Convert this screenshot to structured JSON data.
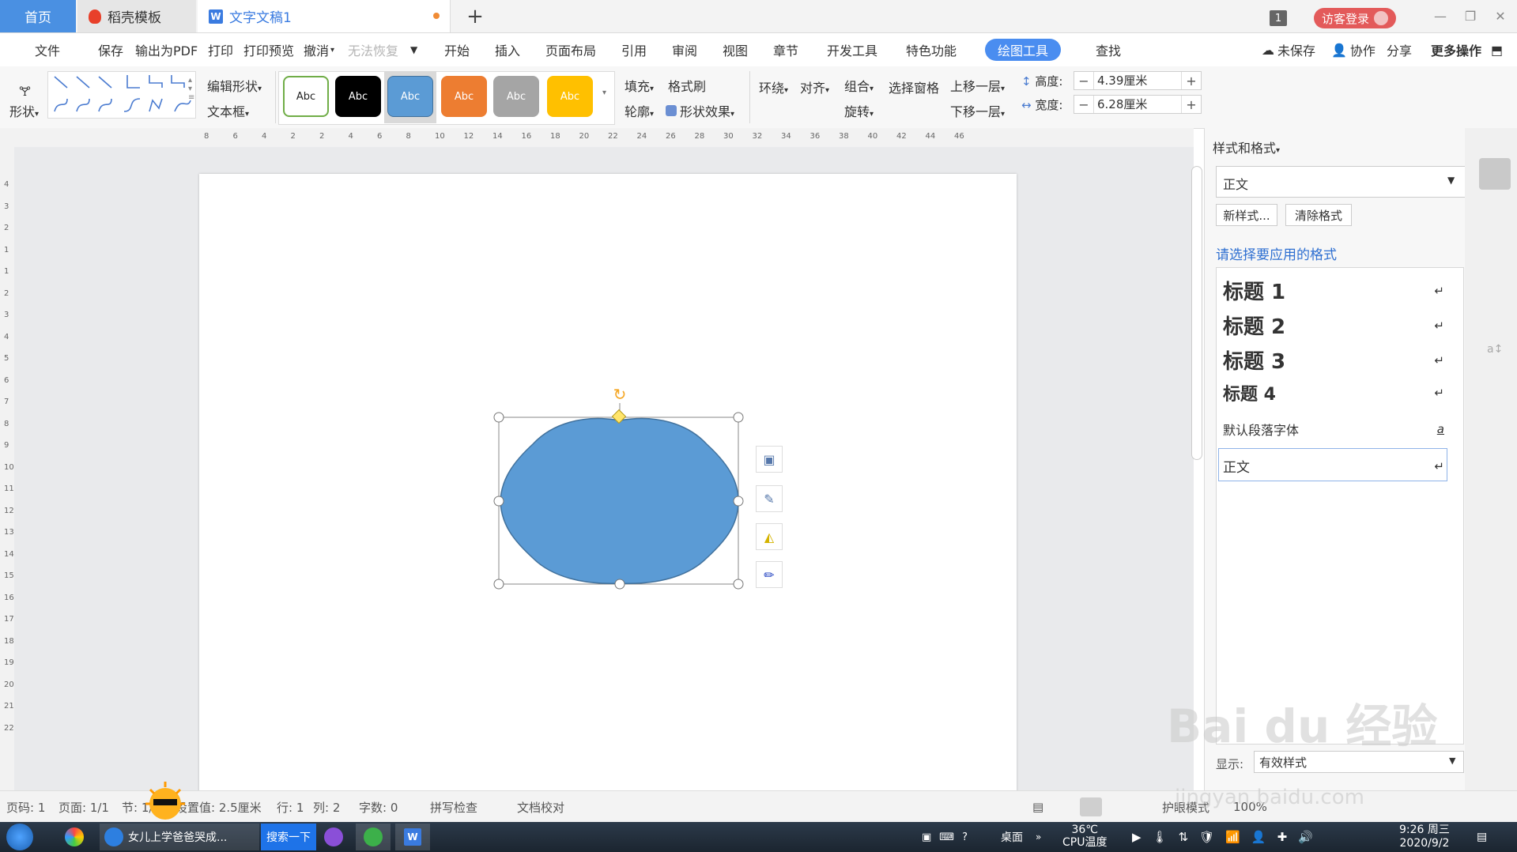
{
  "tabs": {
    "home": "首页",
    "templates": "稻壳模板",
    "doc_icon": "W",
    "document": "文字文稿1",
    "add": "+"
  },
  "title_right": {
    "badge": "1",
    "login": "访客登录"
  },
  "menu": {
    "file": "文件",
    "save": "保存",
    "export_pdf": "输出为PDF",
    "print": "打印",
    "print_preview": "打印预览",
    "undo": "撤消",
    "redo": "无法恢复",
    "start": "开始",
    "insert": "插入",
    "page_layout": "页面布局",
    "references": "引用",
    "review": "审阅",
    "view": "视图",
    "chapter": "章节",
    "dev_tools": "开发工具",
    "special": "特色功能",
    "drawing_tools": "绘图工具",
    "find": "查找",
    "unsaved": "未保存",
    "collaborate": "协作",
    "share": "分享",
    "more": "更多操作"
  },
  "ribbon": {
    "shape": "形状",
    "edit_shape": "编辑形状",
    "text_box": "文本框",
    "style_samples": [
      "Abc",
      "Abc",
      "Abc",
      "Abc",
      "Abc",
      "Abc"
    ],
    "fill": "填充",
    "format_painter": "格式刷",
    "outline": "轮廓",
    "shape_effects": "形状效果",
    "wrap": "环绕",
    "align": "对齐",
    "group": "组合",
    "rotate": "旋转",
    "selection_pane": "选择窗格",
    "bring_forward": "上移一层",
    "send_backward": "下移一层",
    "height_label": "高度:",
    "height_value": "4.39厘米",
    "width_label": "宽度:",
    "width_value": "6.28厘米",
    "minus": "−",
    "plus": "+"
  },
  "ruler_h": [
    "8",
    "6",
    "4",
    "2",
    "2",
    "4",
    "6",
    "8",
    "10",
    "12",
    "14",
    "16",
    "18",
    "20",
    "22",
    "24",
    "26",
    "28",
    "30",
    "32",
    "34",
    "36",
    "38",
    "40",
    "42",
    "44",
    "46"
  ],
  "ruler_v": [
    "4",
    "3",
    "2",
    "1",
    "1",
    "2",
    "3",
    "4",
    "5",
    "6",
    "7",
    "8",
    "9",
    "10",
    "11",
    "12",
    "13",
    "14",
    "15",
    "16",
    "17",
    "18",
    "19",
    "20",
    "21",
    "22"
  ],
  "panel": {
    "title": "样式和格式",
    "current_style": "正文",
    "new_style": "新样式...",
    "clear_format": "清除格式",
    "apply_hint": "请选择要应用的格式",
    "styles": [
      {
        "name": "标题  1",
        "mark": "↵"
      },
      {
        "name": "标题  2",
        "mark": "↵"
      },
      {
        "name": "标题  3",
        "mark": "↵"
      },
      {
        "name": "标题  4",
        "mark": "↵"
      },
      {
        "name": "默认段落字体",
        "mark": "a"
      },
      {
        "name": "正文",
        "mark": "↵"
      }
    ],
    "show_label": "显示:",
    "show_value": "有效样式"
  },
  "status": {
    "page_no": "页码: 1",
    "pages": "页面: 1/1",
    "section": "节: 1/1",
    "setting": "设置值: 2.5厘米",
    "row": "行: 1",
    "col": "列: 2",
    "words": "字数: 0",
    "spell": "拼写检查",
    "proof": "文档校对",
    "lang": "护眼模式",
    "zoom": "100%"
  },
  "taskbar": {
    "browser_item": "女儿上学爸爸哭成...",
    "search": "搜索一下",
    "desktop": "桌面",
    "temp": "36℃",
    "cpu": "CPU温度",
    "time": "9:26 周三",
    "date": "2020/9/2"
  },
  "watermark": {
    "text": "Bai du 经验",
    "url": "jingyan.baidu.com"
  },
  "colors": {
    "accent": "#4a8df0",
    "shape_fill": "#5b9bd5",
    "shape_outline": "#41719c",
    "login": "#e35a5a",
    "style_white": "#ffffff",
    "style_black": "#000000",
    "style_blue": "#5b9bd5",
    "style_orange": "#ed7d31",
    "style_gray": "#a5a5a5",
    "style_gold": "#ffc000"
  }
}
